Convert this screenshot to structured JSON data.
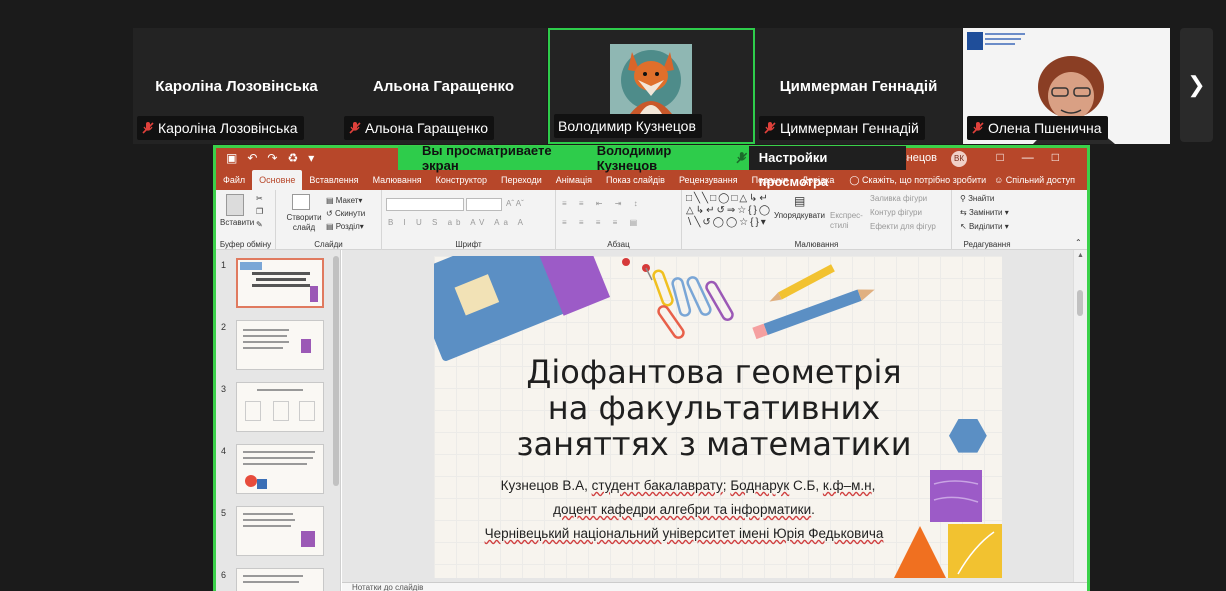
{
  "participants": [
    {
      "display_name": "Кароліна Лозовінська",
      "tag": "Кароліна Лозовінська",
      "muted": true
    },
    {
      "display_name": "Альона Гаращенко",
      "tag": "Альона Гаращенко",
      "muted": true
    },
    {
      "display_name": "",
      "tag": "Володимир Кузнецов",
      "muted": false,
      "speaking": true
    },
    {
      "display_name": "Циммерман Геннадій",
      "tag": "Циммерман Геннадій",
      "muted": true
    },
    {
      "display_name": "",
      "tag": "Олена Пшенична",
      "muted": true
    }
  ],
  "share_banner": {
    "viewing_text": "Вы просматриваете экран",
    "presenter": "Володимир Кузнецов",
    "settings": "Настройки просмотра"
  },
  "ppt": {
    "title_doc": "Кузнецов",
    "avatar": "ВК",
    "menu": [
      "Файл",
      "Основне",
      "Вставлення",
      "Малювання",
      "Конструктор",
      "Переходи",
      "Анімація",
      "Показ слайдів",
      "Рецензування",
      "Подання",
      "Довідка"
    ],
    "selected_menu": "Основне",
    "tell_me": "Скажіть, що потрібно зробити",
    "share_label": "Спільний доступ",
    "ribbon": {
      "paste": "Вставити",
      "clipboard": "Буфер обміну",
      "new_slide": "Створити слайд",
      "layout": "Макет",
      "reset": "Скинути",
      "section": "Розділ",
      "slides": "Слайди",
      "font": "Шрифт",
      "paragraph": "Абзац",
      "arrange": "Упорядкувати",
      "quick_styles": "Експрес-стилі",
      "shape_fill": "Заливка фігури",
      "shape_outline": "Контур фігури",
      "shape_effects": "Ефекти для фігур",
      "drawing": "Малювання",
      "find": "Знайти",
      "replace": "Замінити",
      "select": "Виділити",
      "editing": "Редагування"
    },
    "thumbnails": [
      "1",
      "2",
      "3",
      "4",
      "5",
      "6"
    ],
    "notes": "Нотатки до слайдів"
  },
  "slide": {
    "title": [
      "Діофантова геометрія",
      "на факультативних",
      "заняттях з математики"
    ],
    "line1_a": "Кузнецов В.А, ",
    "line1_b": "студент бакалаврату",
    "line1_c": "; ",
    "line1_d": "Боднарук",
    "line1_e": " С.Б, ",
    "line1_f": "к.ф–м.н",
    "line1_g": ",",
    "line2_a": "доцент кафедри алгебри та інформатики",
    "line2_b": ".",
    "line3": "Чернівецький національний університет імені Юрія Федьковича"
  },
  "colors": {
    "speaking_border": "#2ecc4b",
    "ppt_accent": "#b7472a",
    "muted_icon": "#e0413b"
  }
}
